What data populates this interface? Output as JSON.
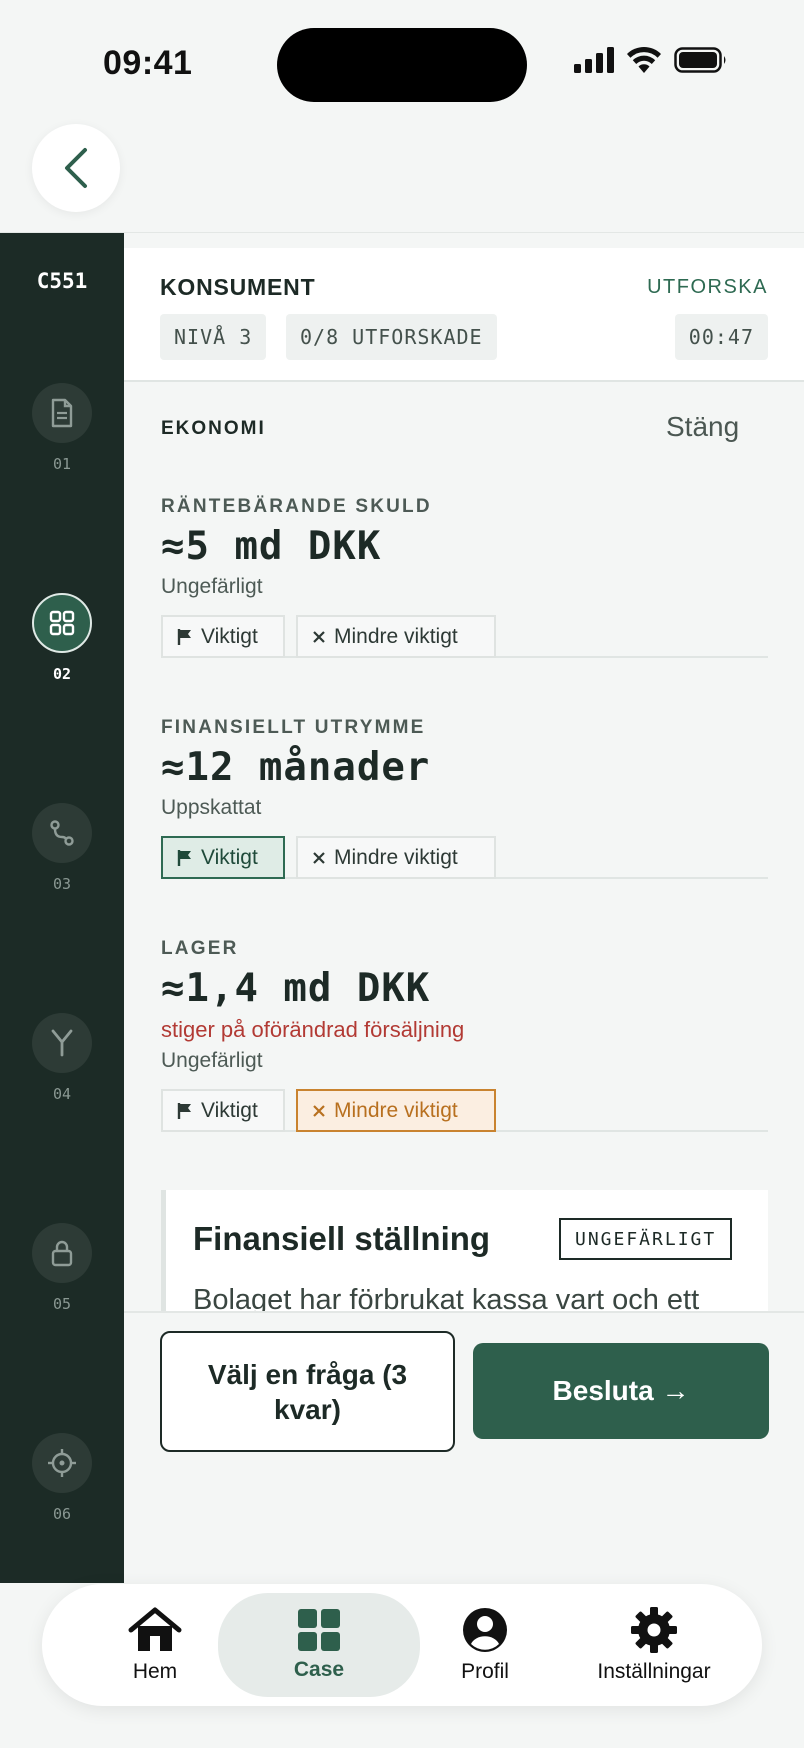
{
  "status_bar": {
    "time": "09:41"
  },
  "rail": {
    "case_code": "C551",
    "steps": [
      {
        "num": "01",
        "icon": "document-icon"
      },
      {
        "num": "02",
        "icon": "grid-icon"
      },
      {
        "num": "03",
        "icon": "route-icon"
      },
      {
        "num": "04",
        "icon": "fork-icon"
      },
      {
        "num": "05",
        "icon": "lock-icon"
      },
      {
        "num": "06",
        "icon": "crosshair-icon"
      }
    ],
    "active_step": "02"
  },
  "header": {
    "title": "KONSUMENT",
    "mode": "UTFORSKA",
    "level": "NIVÅ 3",
    "explored": "0/8 UTFORSKADE",
    "timer": "00:47"
  },
  "section": {
    "label": "EKONOMI",
    "close": "Stäng",
    "items": [
      {
        "label": "RÄNTEBÄRANDE SKULD",
        "value": "≈5 md DKK",
        "note": "",
        "qualifier": "Ungefärligt",
        "selected": "none"
      },
      {
        "label": "FINANSIELLT UTRYMME",
        "value": "≈12 månader",
        "note": "",
        "qualifier": "Uppskattat",
        "selected": "important"
      },
      {
        "label": "LAGER",
        "value": "≈1,4 md DKK",
        "note": "stiger på oförändrad försäljning",
        "qualifier": "Ungefärligt",
        "selected": "less"
      }
    ],
    "important_label": "Viktigt",
    "less_label": "Mindre viktigt"
  },
  "summary": {
    "title": "Finansiell ställning",
    "badge": "UNGEFÄRLIGT",
    "text": "Bolaget har förbrukat kassa vart och ett"
  },
  "actions": {
    "ask": "Välj en fråga (3 kvar)",
    "decide": "Besluta →"
  },
  "tab_bar": {
    "tabs": [
      {
        "label": "Hem",
        "icon": "home-icon"
      },
      {
        "label": "Case",
        "icon": "grid-icon"
      },
      {
        "label": "Profil",
        "icon": "profile-icon"
      },
      {
        "label": "Inställningar",
        "icon": "gear-icon"
      }
    ],
    "active": "Case"
  },
  "colors": {
    "rail_bg": "#1c2b26",
    "accent": "#2e5f4c",
    "warning": "#b23a34",
    "less_selected": "#c9832f"
  }
}
